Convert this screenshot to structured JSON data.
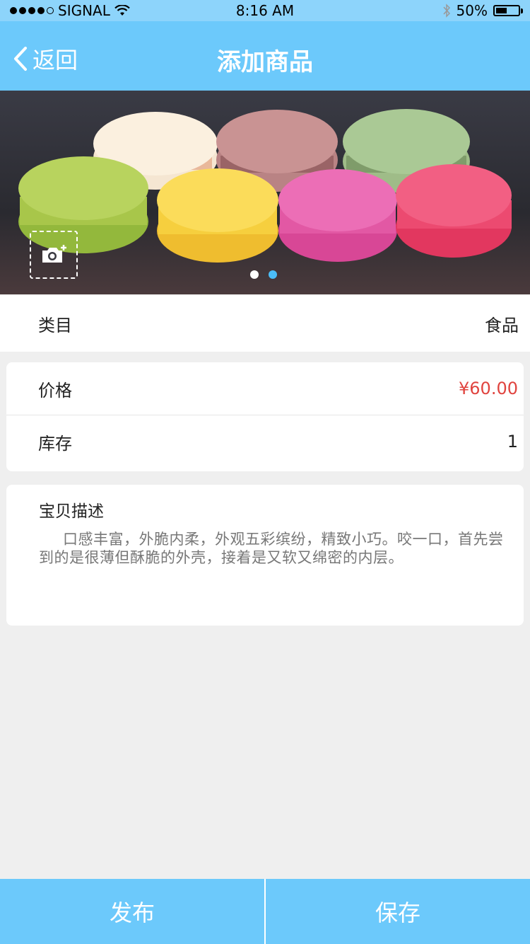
{
  "status": {
    "carrier": "SIGNAL",
    "time": "8:16 AM",
    "battery": "50%",
    "battery_level": 0.5
  },
  "nav": {
    "back_label": "返回",
    "title": "添加商品"
  },
  "banner": {
    "page_count": 2,
    "active_page": 2
  },
  "category": {
    "label": "类目",
    "value": "食品"
  },
  "price": {
    "label": "价格",
    "value": "¥60.00"
  },
  "stock": {
    "label": "库存",
    "value": "1"
  },
  "description": {
    "title": "宝贝描述",
    "text": "口感丰富，外脆内柔，外观五彩缤纷，精致小巧。咬一口，首先尝到的是很薄但酥脆的外壳，接着是又软又绵密的内层。"
  },
  "actions": {
    "publish_label": "发布",
    "save_label": "保存"
  },
  "colors": {
    "primary": "#6cc9fb",
    "status_bar": "#8dd4fb",
    "price": "#e0443f",
    "background": "#efefef"
  },
  "icons": [
    "back-chevron-icon",
    "camera-add-icon",
    "wifi-icon",
    "bluetooth-icon",
    "battery-icon"
  ]
}
